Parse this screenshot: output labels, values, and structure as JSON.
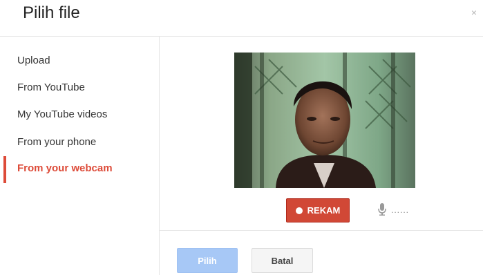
{
  "dialog": {
    "title": "Pilih file",
    "close_symbol": "×"
  },
  "sidebar": {
    "items": [
      {
        "label": "Upload"
      },
      {
        "label": "From YouTube"
      },
      {
        "label": "My YouTube videos"
      },
      {
        "label": "From your phone"
      },
      {
        "label": "From your webcam",
        "active": true
      }
    ]
  },
  "webcam": {
    "icons": [
      "webcam-preview"
    ],
    "record_label": "REKAM",
    "mic_level_text": "......",
    "mic_icon": "microphone-icon"
  },
  "footer": {
    "select_label": "Pilih",
    "cancel_label": "Batal"
  },
  "colors": {
    "accent": "#dd4b39",
    "record_button": "#d14836",
    "primary_disabled": "#a7c8f6",
    "divider": "#e5e5e5"
  }
}
